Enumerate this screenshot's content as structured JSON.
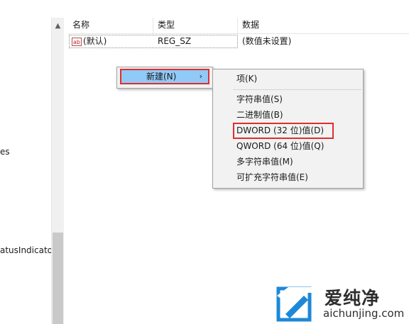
{
  "tree": {
    "partial_items": [
      "es",
      "atusIndicator"
    ]
  },
  "list": {
    "columns": [
      "名称",
      "类型",
      "数据"
    ],
    "rows": [
      {
        "icon": "string-value-icon",
        "icon_text": "ab",
        "name": "(默认)",
        "type": "REG_SZ",
        "data": "(数值未设置)"
      }
    ]
  },
  "context_menu": {
    "new_label": "新建(N)",
    "arrow": "›"
  },
  "submenu": {
    "items": [
      "项(K)",
      "字符串值(S)",
      "二进制值(B)",
      "DWORD (32 位)值(D)",
      "QWORD (64 位)值(Q)",
      "多字符串值(M)",
      "可扩充字符串值(E)"
    ]
  },
  "colors": {
    "highlight": "#91c9f7",
    "annotation_red": "#e02d2d"
  },
  "watermark": {
    "brand": "爱纯净",
    "url": "aichunjing.com"
  }
}
